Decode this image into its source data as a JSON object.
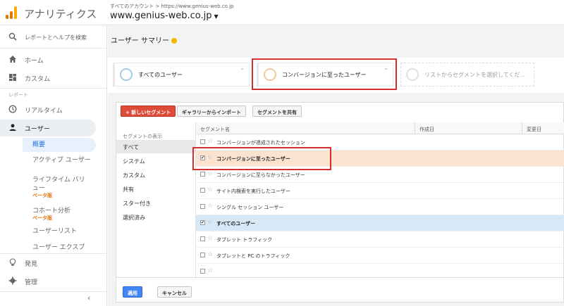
{
  "header": {
    "app_title": "アナリティクス",
    "breadcrumb": "すべてのアカウント > https://www.genius-web.co.jp",
    "property": "www.genius-web.co.jp",
    "logo_colors": [
      "#f9ab00",
      "#e37400",
      "#e37400"
    ]
  },
  "sidebar": {
    "search_label": "レポートとヘルプを検索",
    "home": "ホーム",
    "custom": "カスタム",
    "reports_section": "レポート",
    "realtime": "リアルタイム",
    "user": "ユーザー",
    "sub": {
      "overview": "概要",
      "active_users": "アクティブ ユーザー",
      "ltv_line1": "ライフタイム バリ",
      "ltv_line2": "ュー",
      "ltv_beta": "ベータ版",
      "cohort": "コホート分析",
      "cohort_beta": "ベータ版",
      "user_list": "ユーザーリスト",
      "user_explorer": "ユーザー エクスプ"
    },
    "discover": "発見",
    "admin": "管理",
    "collapse": "‹"
  },
  "main": {
    "page_title": "ユーザー サマリー",
    "segments": [
      {
        "label": "すべてのユーザー",
        "ring_color": "#9fcde8"
      },
      {
        "label": "コンバージョンに至ったユーザー",
        "ring_color": "#f2c99b"
      },
      {
        "label": "リストからセグメントを選択してくだ...",
        "ring_color": "#e0e0e0"
      }
    ],
    "chevron": "⌄"
  },
  "panel": {
    "buttons": {
      "new_segment": "+ 新しいセグメント",
      "import_gallery": "ギャラリーからインポート",
      "share_segment": "セグメントを共有",
      "apply": "適用",
      "cancel": "キャンセル"
    },
    "filter_heading": "セグメントの表示",
    "filters": [
      "すべて",
      "システム",
      "カスタム",
      "共有",
      "スター付き",
      "選択済み"
    ],
    "columns": {
      "name": "セグメント名",
      "created": "作成日",
      "modified": "変更日"
    },
    "rows": [
      {
        "name": "コンバージョンが達成されたセッション",
        "checked": ""
      },
      {
        "name": "コンバージョンに至ったユーザー",
        "checked": "✔"
      },
      {
        "name": "コンバージョンに至らなかったユーザー",
        "checked": ""
      },
      {
        "name": "サイト内検索を実行したユーザー",
        "checked": ""
      },
      {
        "name": "シングル セッション ユーザー",
        "checked": ""
      },
      {
        "name": "すべてのユーザー",
        "checked": "✔"
      },
      {
        "name": "タブレット トラフィック",
        "checked": ""
      },
      {
        "name": "タブレットと PC のトラフィック",
        "checked": ""
      }
    ]
  }
}
